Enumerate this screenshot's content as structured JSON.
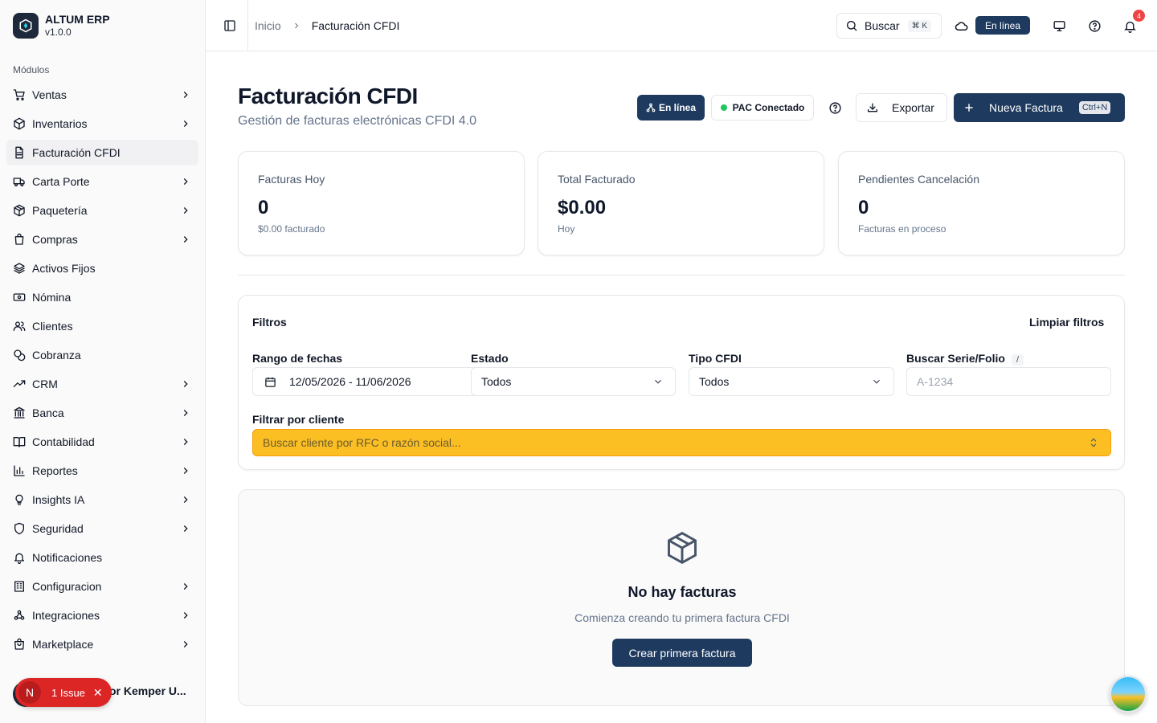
{
  "brand": {
    "name": "ALTUM ERP",
    "version": "v1.0.0"
  },
  "sidebar": {
    "section_label": "Módulos",
    "items": [
      {
        "label": "Ventas",
        "icon": "cart-icon",
        "has_children": true
      },
      {
        "label": "Inventarios",
        "icon": "box-icon",
        "has_children": true
      },
      {
        "label": "Facturación CFDI",
        "icon": "file-text-icon",
        "has_children": false,
        "active": true
      },
      {
        "label": "Carta Porte",
        "icon": "truck-icon",
        "has_children": true
      },
      {
        "label": "Paquetería",
        "icon": "package-icon",
        "has_children": true
      },
      {
        "label": "Compras",
        "icon": "shopping-bag-icon",
        "has_children": true
      },
      {
        "label": "Activos Fijos",
        "icon": "layers-icon",
        "has_children": false
      },
      {
        "label": "Nómina",
        "icon": "banknote-icon",
        "has_children": false
      },
      {
        "label": "Clientes",
        "icon": "users-icon",
        "has_children": false
      },
      {
        "label": "Cobranza",
        "icon": "coins-icon",
        "has_children": false
      },
      {
        "label": "CRM",
        "icon": "trending-up-icon",
        "has_children": true
      },
      {
        "label": "Banca",
        "icon": "bank-icon",
        "has_children": true
      },
      {
        "label": "Contabilidad",
        "icon": "book-open-icon",
        "has_children": true
      },
      {
        "label": "Reportes",
        "icon": "bar-chart-icon",
        "has_children": true
      },
      {
        "label": "Insights IA",
        "icon": "lightbulb-icon",
        "has_children": true
      },
      {
        "label": "Seguridad",
        "icon": "shield-icon",
        "has_children": true
      },
      {
        "label": "Notificaciones",
        "icon": "bell-icon",
        "has_children": false
      },
      {
        "label": "Configuracion",
        "icon": "building-icon",
        "has_children": true
      },
      {
        "label": "Integraciones",
        "icon": "webhook-icon",
        "has_children": true
      },
      {
        "label": "Marketplace",
        "icon": "store-icon",
        "has_children": true
      }
    ],
    "footer_user": "or Kemper U...",
    "issue": {
      "letter": "N",
      "label": "1 Issue"
    }
  },
  "topbar": {
    "breadcrumb_home": "Inicio",
    "breadcrumb_current": "Facturación CFDI",
    "search_label": "Buscar",
    "search_shortcut": "⌘ K",
    "status": "En línea",
    "notifications_count": "4"
  },
  "page": {
    "title": "Facturación CFDI",
    "subtitle": "Gestión de facturas electrónicas CFDI 4.0",
    "online_label": "En línea",
    "pac_label": "PAC Conectado",
    "export_label": "Exportar",
    "new_label": "Nueva Factura",
    "new_shortcut": "Ctrl+N"
  },
  "stats": [
    {
      "label": "Facturas Hoy",
      "value": "0",
      "sub": "$0.00 facturado"
    },
    {
      "label": "Total Facturado",
      "value": "$0.00",
      "sub": "Hoy"
    },
    {
      "label": "Pendientes Cancelación",
      "value": "0",
      "sub": "Facturas en proceso"
    }
  ],
  "filters": {
    "title": "Filtros",
    "clear_label": "Limpiar filtros",
    "date_range_label": "Rango de fechas",
    "date_range_value": "12/05/2026 - 11/06/2026",
    "estado_label": "Estado",
    "estado_value": "Todos",
    "tipo_label": "Tipo CFDI",
    "tipo_value": "Todos",
    "serie_label": "Buscar Serie/Folio",
    "serie_shortcut": "/",
    "serie_placeholder": "A-1234",
    "client_label": "Filtrar por cliente",
    "client_placeholder": "Buscar cliente por RFC o razón social..."
  },
  "empty_state": {
    "title": "No hay facturas",
    "subtitle": "Comienza creando tu primera factura CFDI",
    "button_label": "Crear primera factura"
  },
  "colors": {
    "primary": "#1e3a5f",
    "accent_yellow": "#fbbf24",
    "success": "#22c55e",
    "danger": "#dc2626"
  }
}
